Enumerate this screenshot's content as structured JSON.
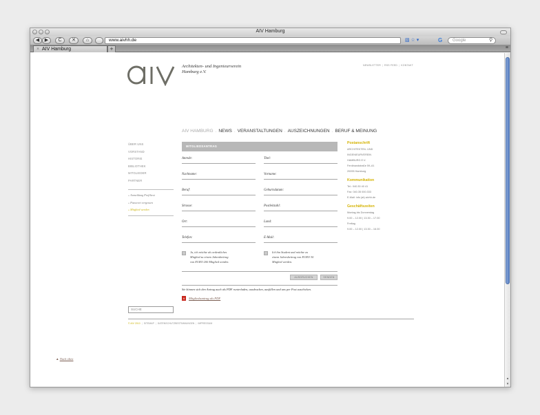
{
  "browser": {
    "window_title": "AIV Hamburg",
    "url": "www.aivhh.de",
    "search_placeholder": "Google",
    "tab_title": "AIV Hamburg",
    "tab_close": "×",
    "new_tab": "+",
    "btn_back": "◀",
    "btn_forward": "▶",
    "btn_reload": "C",
    "btn_stop": "✕",
    "btn_home": "⌂",
    "url_icons": "▧ ☆ ▾",
    "search_icon_glyph": "⚲",
    "tab_menu_glyph": "≡"
  },
  "brand": {
    "logo_text": "aiv",
    "logo_color": "#6e6e66",
    "name_line1": "Architekten- und Ingenieurverein",
    "name_line2": "Hamburg e.V."
  },
  "top_links": [
    "NEWSLETTER",
    "RSS FEED",
    "KONTAKT"
  ],
  "main_nav": [
    {
      "label": "AIV HAMBURG",
      "state": "dim"
    },
    {
      "label": "NEWS",
      "state": "strong"
    },
    {
      "label": "VERANSTALTUNGEN",
      "state": "strong"
    },
    {
      "label": "AUSZEICHNUNGEN",
      "state": "strong"
    },
    {
      "label": "BERUF & MEINUNG",
      "state": "strong"
    }
  ],
  "side_nav": {
    "items": [
      "ÜBER UNS",
      "VORSTAND",
      "HISTORIE",
      "BIBLIOTHEK",
      "MITGLIEDER",
      "PARTNER"
    ],
    "sub_items": [
      {
        "label": "» Anmeldung Profiltext",
        "active": false
      },
      {
        "label": "» Passwort vergessen",
        "active": false
      },
      {
        "label": "» Mitglied werden",
        "active": true
      }
    ],
    "search_placeholder": "SUCHE"
  },
  "form": {
    "header": "MITGLIEDSANTRAG",
    "left_fields": [
      "Anrede:",
      "Nachname:",
      "Beruf:",
      "Strasse:",
      "Ort:",
      "Telefon:"
    ],
    "right_fields": [
      "Titel:",
      "Vorname:",
      "Geburtsdatum:",
      "Postleitzahl:",
      "Land:",
      "E-Mail:"
    ],
    "checkbox_left_lines": [
      "Ja, ich möchte als ordentliches",
      "Mitglied zu einem Jahresbeitrag",
      "von EURO 200 Mitglied werden."
    ],
    "checkbox_right_lines": [
      "Ich bin Student und möchte zu",
      "einem Jahresbeitrag von EURO 30",
      "Mitglied werden."
    ],
    "print_label": "AUSDRUCKEN",
    "send_label": "SENDEN",
    "pdf_text": "Sie können sich den Antrag auch als PDF runterladen, ausdrucken, ausfüllen und uns per Post zuschicken.",
    "pdf_icon_text": "A",
    "pdf_link": "Mitgliedsantrag als PDF"
  },
  "right_col": {
    "postanschrift": {
      "title": "Postanschrift",
      "lines": [
        "ARCHITEKTEN- UND",
        "INGENIEURVEREIN",
        "HAMBURG E.V.",
        "Ferdinandstraße 59–61",
        "20095 Hamburg"
      ]
    },
    "kommunikation": {
      "title": "Kommunikation",
      "lines": [
        "Tel.: 040.30 40 41",
        "Fax: 040.35 000.333",
        "E-Mail: info (at) aivhh.de"
      ]
    },
    "geschaeftszeiten": {
      "title": "Geschäftszeiten",
      "lines": [
        "Montag bis Donnerstag",
        "9.00 – 12.00 | 13.30 – 17.00",
        "Freitag",
        "9.00 – 12.00 | 13.30 – 16.00"
      ]
    }
  },
  "footer": {
    "copyright": "© AIV 2010",
    "links": [
      "SITEMAP",
      "DATENSCHUTZBESTIMMUNGEN",
      "IMPRESSUM"
    ]
  },
  "back_to_top": "Nach oben",
  "back_to_top_arrow": "▲",
  "scrollbar": {
    "up_arrow": "▴",
    "down_arrow": "▾"
  },
  "colors": {
    "accent_yellow": "#d4b200",
    "form_header_bg": "#b8b8b8",
    "link_brown": "#7a5c50"
  }
}
